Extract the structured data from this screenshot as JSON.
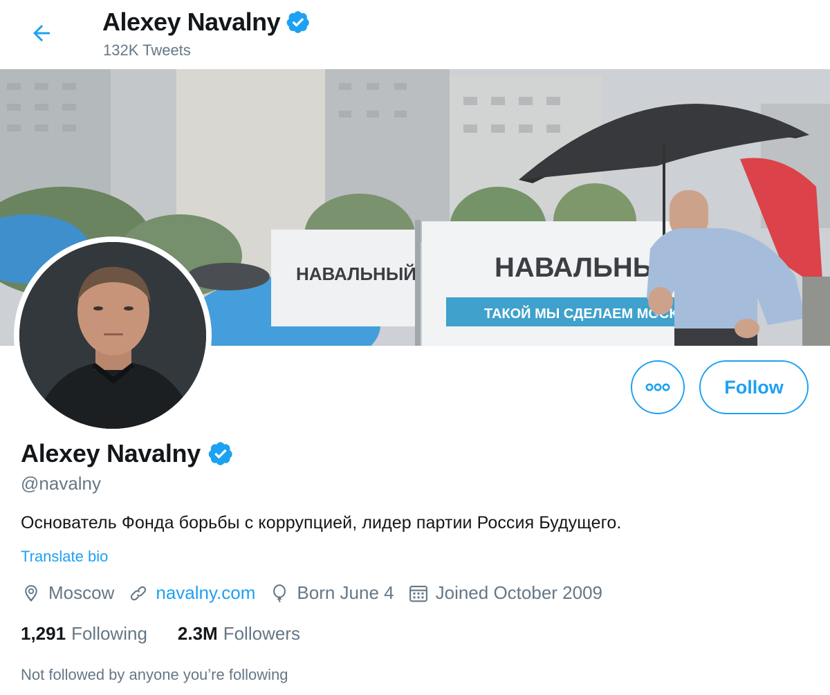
{
  "header": {
    "back_icon": "arrow-left-icon",
    "name": "Alexey Navalny",
    "verified_icon": "verified-badge-icon",
    "tweet_count": "132K Tweets"
  },
  "banner": {
    "sign_left": "НАВАЛЬНЫЙ",
    "sign_right": "НАВАЛЬНЫ",
    "sign_subtitle": "ТАКОЙ МЫ СДЕЛАЕМ МОСК"
  },
  "actions": {
    "more_icon": "more-horizontal-icon",
    "follow_label": "Follow"
  },
  "profile": {
    "name": "Alexey Navalny",
    "handle": "@navalny",
    "bio": "Основатель Фонда борьбы с коррупцией, лидер партии Россия Будущего.",
    "translate_label": "Translate bio",
    "location": "Moscow",
    "website": "navalny.com",
    "birthday": "Born June 4",
    "joined": "Joined October 2009",
    "following_count": "1,291",
    "following_label": "Following",
    "followers_count": "2.3M",
    "followers_label": "Followers",
    "followed_note": "Not followed by anyone you’re following"
  },
  "colors": {
    "accent": "#1da1f2",
    "secondary_text": "#657786",
    "primary_text": "#14171a"
  }
}
